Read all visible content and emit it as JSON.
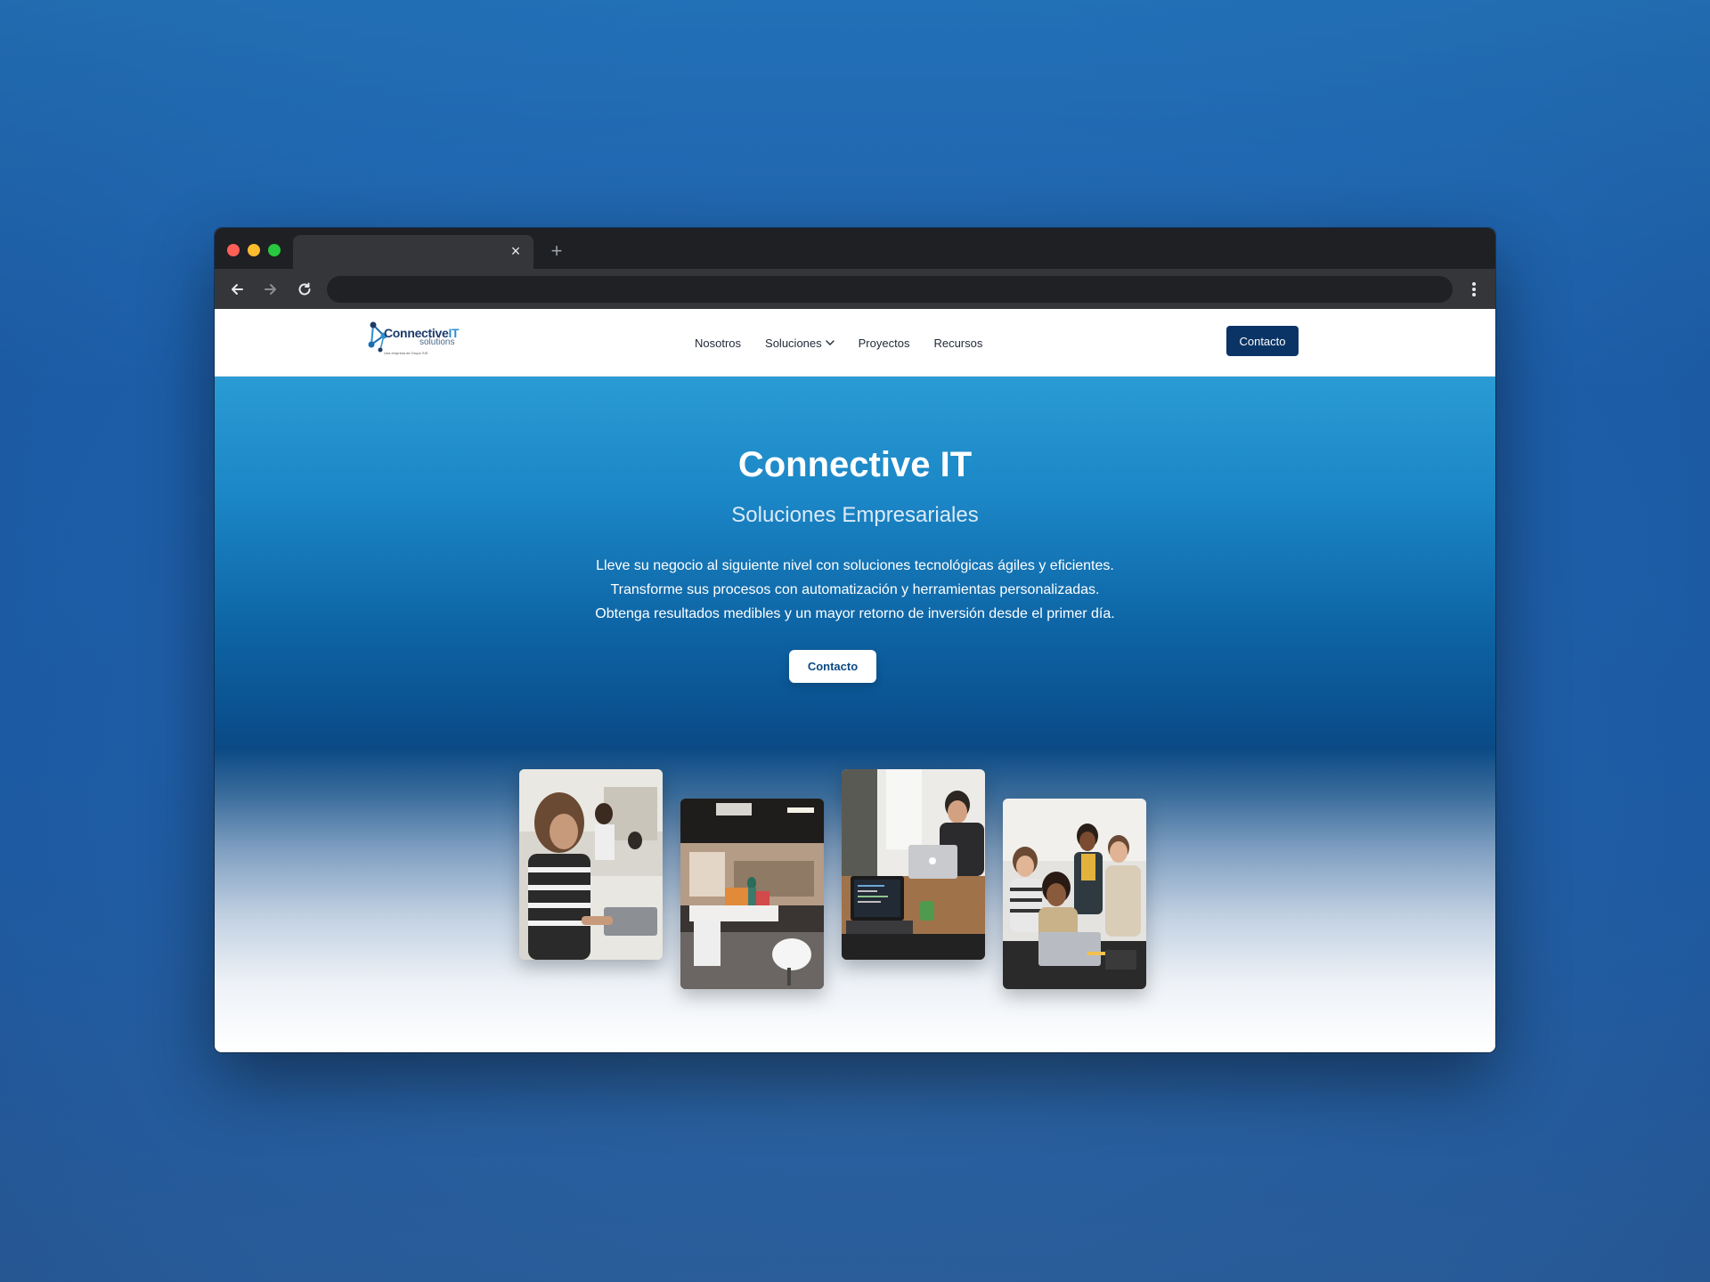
{
  "browser": {
    "tab_close": "×",
    "new_tab": "+"
  },
  "site": {
    "logo": {
      "name_main": "Connective",
      "name_accent": "IT",
      "tagline": "solutions",
      "small_print": "Una empresa de Grupo SIS"
    },
    "nav": {
      "items": [
        "Nosotros",
        "Soluciones",
        "Proyectos",
        "Recursos"
      ],
      "cta": "Contacto"
    },
    "hero": {
      "title": "Connective IT",
      "subtitle": "Soluciones Empresariales",
      "lines": [
        "Lleve su negocio al siguiente nivel con soluciones tecnológicas ágiles y eficientes.",
        "Transforme sus procesos con automatización y herramientas personalizadas.",
        "Obtenga resultados medibles y un mayor retorno de inversión desde el primer día."
      ],
      "cta": "Contacto"
    }
  },
  "colors": {
    "nav_cta_bg": "#0b3466",
    "hero_top": "#2a9bd4",
    "hero_mid": "#0a4e8c"
  }
}
